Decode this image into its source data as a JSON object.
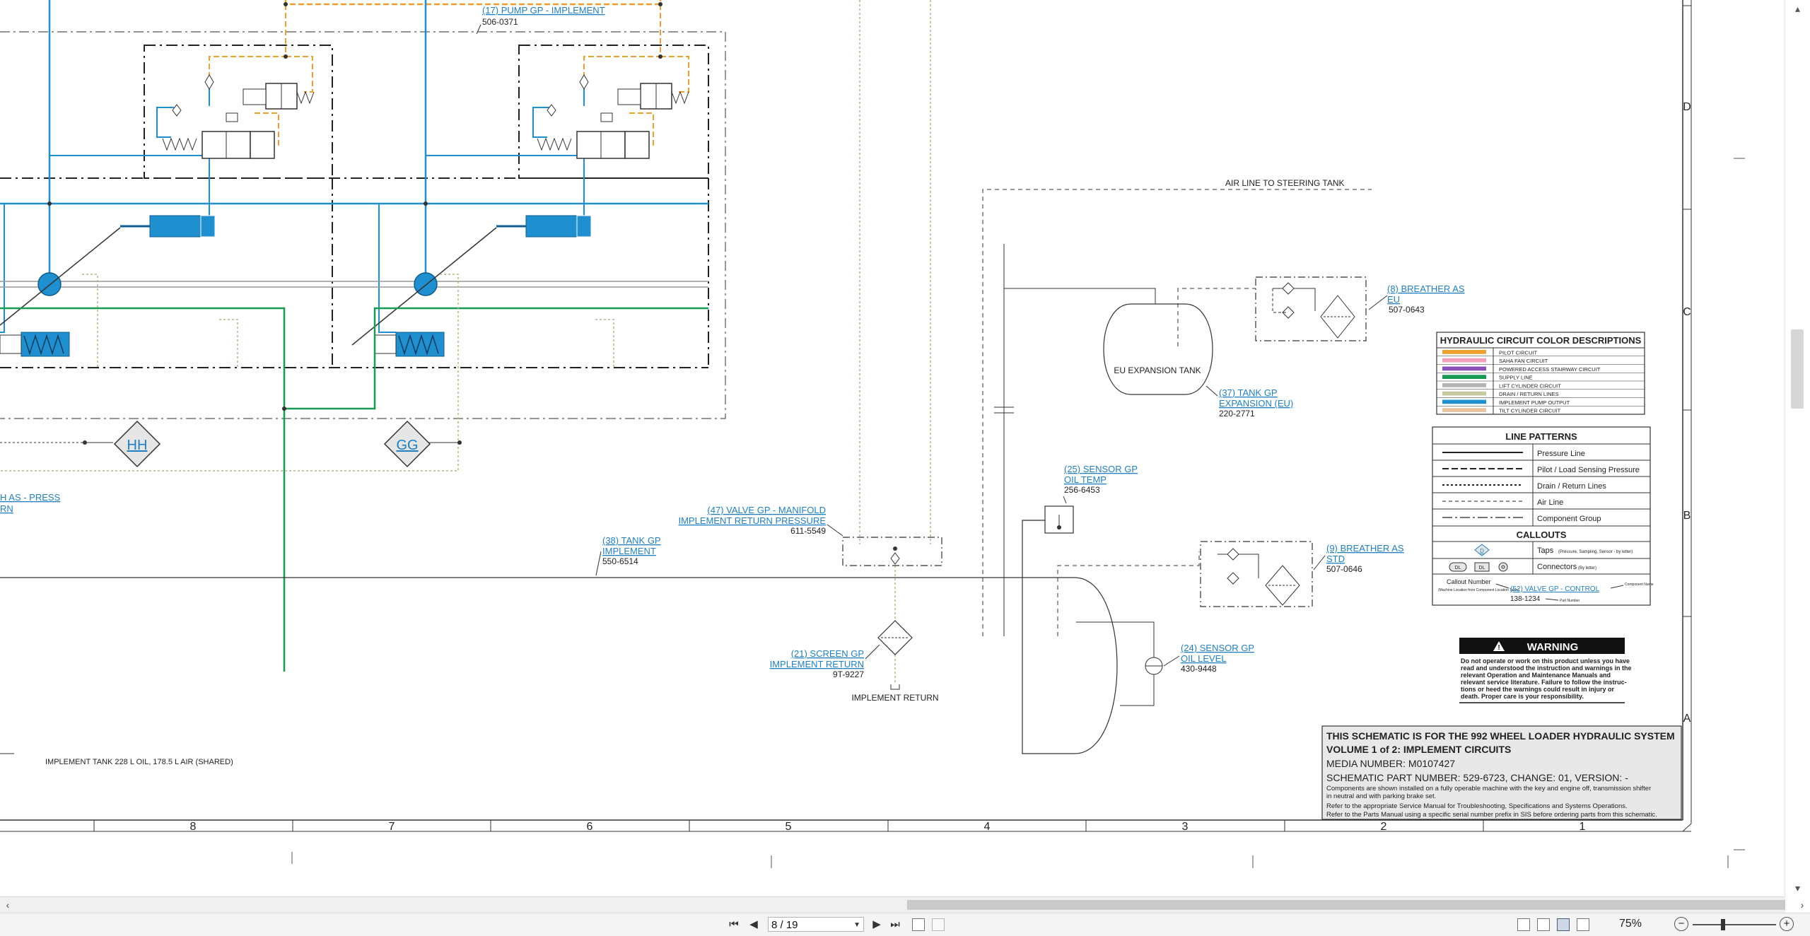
{
  "viewer": {
    "page_current": "8 / 19",
    "zoom": "75%",
    "nav_first": "first-page",
    "nav_prev": "previous-page",
    "nav_next": "next-page",
    "nav_last": "last-page"
  },
  "border": {
    "zone_rows": [
      "D",
      "C",
      "B",
      "A"
    ],
    "zone_cols": [
      "8",
      "7",
      "6",
      "5",
      "4",
      "3",
      "2",
      "1"
    ]
  },
  "callouts": {
    "c17_name": "(17) PUMP GP - IMPLEMENT",
    "c17_part": "506-0371",
    "c8_name1": "(8) BREATHER AS",
    "c8_name2": "EU",
    "c8_part": "507-0643",
    "c37_name1": "(37) TANK GP",
    "c37_name2": "EXPANSION (EU)",
    "c37_part": "220-2771",
    "c25_name1": "(25) SENSOR GP",
    "c25_name2": "OIL TEMP",
    "c25_part": "256-6453",
    "c47_name1": "(47) VALVE GP - MANIFOLD",
    "c47_name2": "IMPLEMENT RETURN PRESSURE",
    "c47_part": "611-5549",
    "c38_name1": "(38) TANK GP",
    "c38_name2": "IMPLEMENT",
    "c38_part": "550-6514",
    "c9_name1": "(9) BREATHER AS",
    "c9_name2": "STD",
    "c9_part": "507-0646",
    "c21_name1": "(21) SCREEN GP",
    "c21_name2": "IMPLEMENT RETURN",
    "c21_part": "9T-9227",
    "c24_name1": "(24) SENSOR GP",
    "c24_name2": "OIL LEVEL",
    "c24_part": "430-9448",
    "left_cut1": "H AS - PRESS",
    "left_cut2": "RN"
  },
  "labels": {
    "air_line": "AIR LINE TO STEERING TANK",
    "eu_tank": "EU EXPANSION TANK",
    "implement_return": "IMPLEMENT RETURN",
    "tank_note": "IMPLEMENT TANK 228 L OIL, 178.5 L AIR (SHARED)",
    "tap_hh": "HH",
    "tap_gg": "GG"
  },
  "color_legend": {
    "title": "HYDRAULIC CIRCUIT COLOR DESCRIPTIONS",
    "items": [
      {
        "label": "PILOT CIRCUIT",
        "color": "#f0a030"
      },
      {
        "label": "SAHA FAN CIRCUIT",
        "color": "#f0a0b8"
      },
      {
        "label": "POWERED ACCESS STAIRWAY CIRCUIT",
        "color": "#8a4fb8"
      },
      {
        "label": "SUPPLY LINE",
        "color": "#1a9a55"
      },
      {
        "label": "LIFT CYLINDER CIRCUIT",
        "color": "#b4b4b4"
      },
      {
        "label": "DRAIN / RETURN LINES",
        "color": "#c8c8a0"
      },
      {
        "label": "IMPLEMENT PUMP OUTPUT",
        "color": "#1f8fd0"
      },
      {
        "label": "TILT CYLINDER CIRCUIT",
        "color": "#e8c4a0"
      }
    ]
  },
  "line_patterns": {
    "title": "LINE PATTERNS",
    "items": [
      "Pressure Line",
      "Pilot / Load Sensing Pressure",
      "Drain / Return Lines",
      "Air Line",
      "Component Group"
    ],
    "callouts_title": "CALLOUTS",
    "taps_label": "Taps",
    "taps_note": "(Pressure, Sampling, Sensor - by letter)",
    "connectors_label": "Connectors",
    "connectors_note": "(By letter)",
    "tap_sym": "D",
    "conn_sym1": "DL",
    "conn_sym2": "DL",
    "ex_callout_number": "Callout Number",
    "ex_note": "(Machine Location from Component Location Table)",
    "ex_name": "(52) VALVE GP - CONTROL",
    "ex_part": "138-1234",
    "ex_component_name": "Component Name",
    "ex_part_number": "Part Number"
  },
  "warning": {
    "title": "WARNING",
    "lines": [
      "Do not operate or work on this product unless you have",
      "read and understood the instruction and warnings in the",
      "relevant Operation and Maintenance Manuals and",
      "relevant service literature. Failure to follow the instruc-",
      "tions or heed the warnings could result in injury or",
      "death. Proper care is your responsibility."
    ]
  },
  "title_block": {
    "line1": "THIS SCHEMATIC IS FOR THE 992 WHEEL LOADER HYDRAULIC SYSTEM",
    "line2": "VOLUME 1 of 2: IMPLEMENT CIRCUITS",
    "line3": "MEDIA NUMBER: M0107427",
    "line4": "SCHEMATIC PART NUMBER: 529-6723, CHANGE: 01, VERSION: -",
    "note1": "Components are shown installed on a fully operable machine with the key and engine off, transmission shifter",
    "note2": "in neutral and with parking brake set.",
    "note3": "Refer to the appropriate Service Manual for Troubleshooting, Specifications and Systems Operations.",
    "note4": "Refer to the Parts Manual using a specific serial number prefix in SIS before ordering parts from this schematic."
  }
}
